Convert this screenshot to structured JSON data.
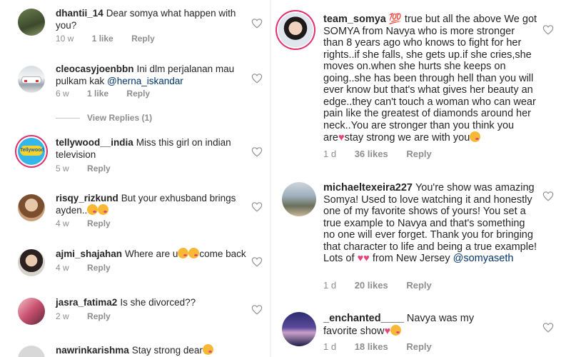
{
  "left": {
    "comments": [
      {
        "user": "dhantii_14",
        "text": "Dear somya what happen with you?",
        "time": "10 w",
        "likes": "1 like",
        "reply": "Reply"
      },
      {
        "user": "cleocasyjoenbbn",
        "text": "Ini dlm perjalanan mau pulkam kak ",
        "mention": "@herna_iskandar",
        "time": "6 w",
        "likes": "1 like",
        "reply": "Reply"
      },
      {
        "user": "tellywood__india",
        "text": "Miss this girl on indian television",
        "time": "5 w",
        "reply": "Reply",
        "avatar_label": "Tellywood"
      },
      {
        "user": "risqy_rizkund",
        "text": "But your exhusband brings ayden..",
        "time": "4 w",
        "reply": "Reply"
      },
      {
        "user": "ajmi_shajahan",
        "text": "Where are u",
        "text2": "come back",
        "time": "4 w",
        "reply": "Reply"
      },
      {
        "user": "jasra_fatima2",
        "text": "Is she divorced??",
        "time": "2 w",
        "reply": "Reply"
      },
      {
        "user": "nawrinkarishma",
        "text": "Stay strong dear"
      }
    ],
    "view_replies": "View Replies (1)"
  },
  "right": {
    "comments": [
      {
        "user": "team_somya",
        "badge": "💯",
        "text": "true but all the above We got SOMYA from Navya who is more stronger than 8 years ago who knows to fight for her rights..if she falls, she gets up.if she cries,she moves on.when she hurts she keeps on going..she has been through hell than you will ever know but that's what gives her beauty an edge..they can't touch a woman who can wear pain like the greatest of diamonds around her neck..You are stronger than you think you are",
        "text_end": "stay strong we are with you",
        "time": "1 d",
        "likes": "36 likes",
        "reply": "Reply"
      },
      {
        "user": "michaeltexeira227",
        "text": "You're show was amazing Somya! Used to love watching it and honestly one of my favorite shows of yours! You set a true example to Navya and that's something no one will ever forget. Thank you for bringing that character to life and being a true example! Lots of",
        "text_mid": "from New Jersey",
        "mention": "@somyaseth",
        "time": "1 d",
        "likes": "20 likes",
        "reply": "Reply"
      },
      {
        "user": "_enchanted____",
        "text": "Navya was my favorite show",
        "time": "1 d",
        "likes": "18 likes",
        "reply": "Reply"
      }
    ]
  },
  "colors": {
    "accent_pink": "#e1306c",
    "meta_gray": "#8e8e8e",
    "mention_blue": "#003569",
    "heart_emoji": "#e6457a"
  },
  "icons": {
    "like": "heart-outline-icon"
  }
}
